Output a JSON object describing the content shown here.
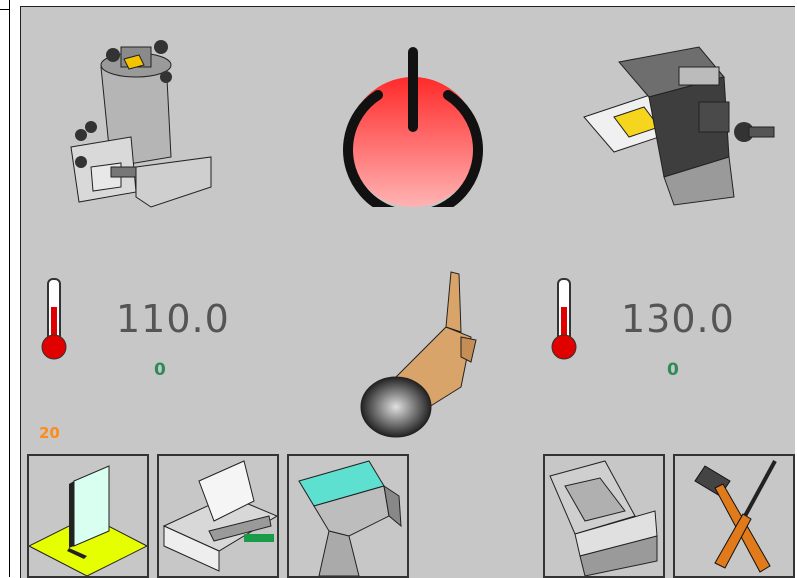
{
  "left": {
    "temperature": "110.0",
    "setpoint": "0"
  },
  "right": {
    "temperature": "130.0",
    "setpoint": "0"
  },
  "counter": "20",
  "colors": {
    "panel": "#c7c7c7",
    "temp_text": "#555555",
    "setpoint_text": "#2e8b57",
    "counter_text": "#ff8c1a",
    "power_red": "#ff3b3b"
  },
  "icons": [
    "press-machine-icon",
    "power-icon",
    "cutter-machine-icon",
    "thermometer-icon",
    "touch-hand-icon",
    "fold-icon",
    "feeder-icon",
    "film-roll-icon",
    "slide-unit-icon",
    "tools-icon"
  ]
}
